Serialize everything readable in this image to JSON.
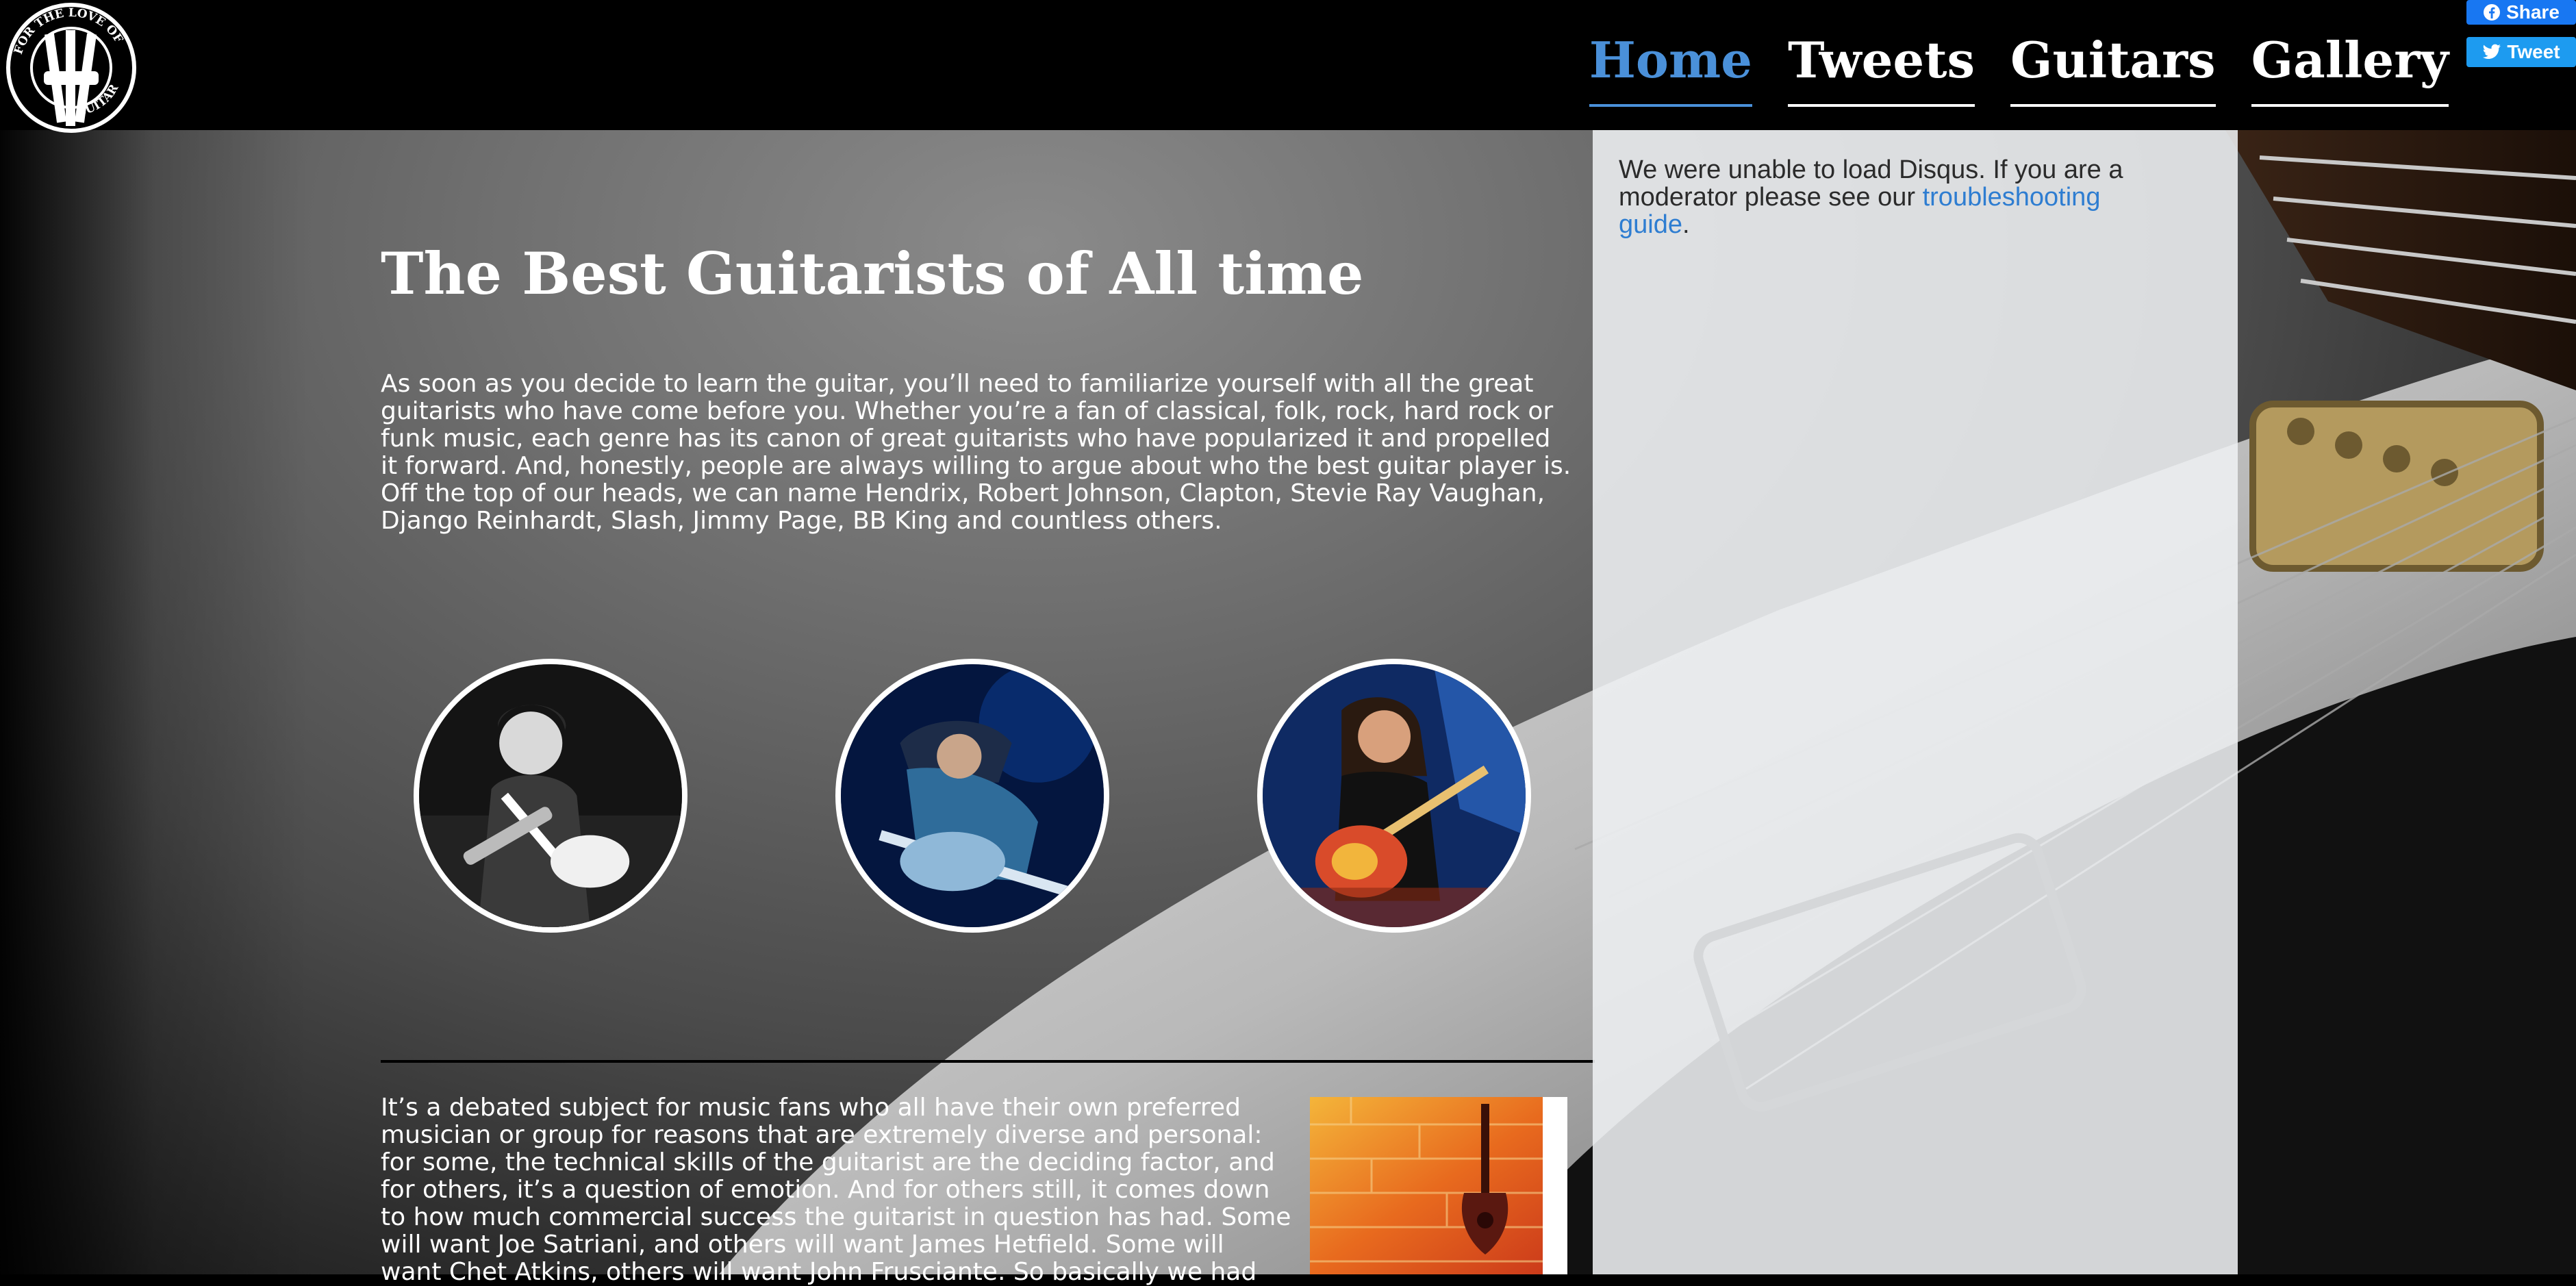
{
  "logo": {
    "text": "FOR THE LOVE OF GUITAR",
    "top_text": "FOR THE LOVE OF",
    "bottom_text": "GUITAR"
  },
  "nav": {
    "items": [
      {
        "label": "Home",
        "active": true
      },
      {
        "label": "Tweets",
        "active": false
      },
      {
        "label": "Guitars",
        "active": false
      },
      {
        "label": "Gallery",
        "active": false
      }
    ]
  },
  "social": {
    "share_label": "Share",
    "tweet_label": "Tweet"
  },
  "main": {
    "title": "The Best Guitarists of All time",
    "intro": "As soon as you decide to learn the guitar, you’ll need to familiarize yourself with all the great guitarists who have come before you. Whether you’re a fan of classical, folk, rock, hard rock or funk music, each genre has its canon of great guitarists who have popularized it and propelled it forward. And, honestly, people are always willing to argue about who the best guitar player is. Off the top of our heads, we can name Hendrix, Robert Johnson, Clapton, Stevie Ray Vaughan, Django Reinhardt, Slash, Jimmy Page, BB King and countless others.",
    "body2": "It’s a debated subject for music fans who all have their own preferred musician or group for reasons that are extremely diverse and personal: for some, the technical skills of the guitarist are the deciding factor, and for others, it’s a question of emotion. And for others still, it comes down to how much commercial success the guitarist in question has had. Some will want Joe Satriani, and others will want James Hetfield. Some will want Chet Atkins, others will want John Frusciante. So basically we had"
  },
  "disqus": {
    "message_prefix": "We were unable to load Disqus. If you are a moderator please see our ",
    "link_text": "troubleshooting guide",
    "message_suffix": "."
  },
  "colors": {
    "accent": "#4a90d9",
    "facebook": "#1877f2",
    "twitter": "#1d9bf0",
    "link": "#2e7dd1"
  }
}
